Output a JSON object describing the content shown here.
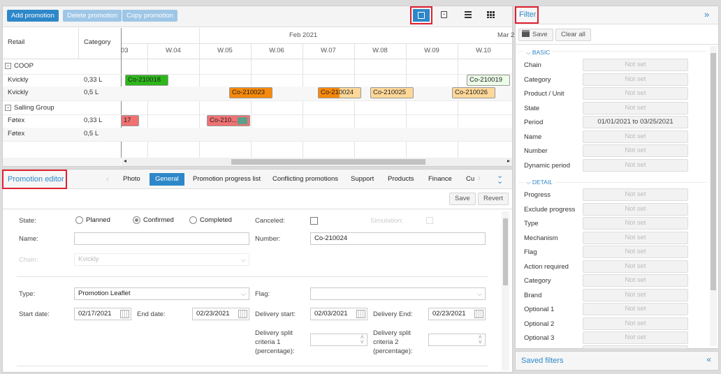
{
  "toolbar": {
    "add": "Add promotion",
    "delete": "Delete promotion",
    "copy": "Copy promotion"
  },
  "grid": {
    "col_retail": "Retail",
    "col_category": "Category",
    "months": [
      "Feb 2021",
      "Mar 2"
    ],
    "weeks": [
      "03",
      "W.04",
      "W.05",
      "W.06",
      "W.07",
      "W.08",
      "W.09",
      "W.10"
    ],
    "rows": [
      {
        "group": "COOP"
      },
      {
        "retail": "Kvickly",
        "category": "0,33 L"
      },
      {
        "retail": "Kvickly",
        "category": "0,5 L"
      },
      {
        "group": "Salling Group"
      },
      {
        "retail": "Føtex",
        "category": "0,33 L"
      },
      {
        "retail": "Føtex",
        "category": "0,5 L"
      }
    ],
    "bars": [
      {
        "label": "Co-210018",
        "color": "#2db71b"
      },
      {
        "label": "Co-210019",
        "color": "#ecfde8"
      },
      {
        "label": "Co-210023",
        "color": "#f7890a"
      },
      {
        "label": "Co-210024",
        "color": "#f7890a"
      },
      {
        "label": "Co-210025",
        "color": "#ffd898"
      },
      {
        "label": "Co-210026",
        "color": "#ffd898"
      },
      {
        "label": "17",
        "color": "#f07272"
      },
      {
        "label": "Co-210...",
        "color": "#f07272"
      }
    ]
  },
  "editor": {
    "title": "Promotion editor",
    "tabs": [
      "Photo",
      "General",
      "Promotion progress list",
      "Conflicting promotions",
      "Support",
      "Products",
      "Finance",
      "Cu:"
    ],
    "active_tab": "General",
    "save": "Save",
    "revert": "Revert",
    "state_label": "State:",
    "states": [
      "Planned",
      "Confirmed",
      "Completed"
    ],
    "state_selected": "Confirmed",
    "canceled_label": "Canceled:",
    "simulation_label": "Simulation:",
    "name_label": "Name:",
    "name_value": "",
    "number_label": "Number:",
    "number_value": "Co-210024",
    "chain_label": "Chain:",
    "chain_value": "Kvickly",
    "type_label": "Type:",
    "type_value": "Promotion Leaflet",
    "flag_label": "Flag:",
    "flag_value": "",
    "start_label": "Start date:",
    "start_value": "02/17/2021",
    "end_label": "End date:",
    "end_value": "02/23/2021",
    "dstart_label": "Delivery start:",
    "dstart_value": "02/03/2021",
    "dend_label": "Delivery End:",
    "dend_value": "02/23/2021",
    "split1_label": [
      "Delivery split",
      "criteria 1",
      "(percentage):"
    ],
    "split2_label": [
      "Delivery split",
      "criteria 2",
      "(percentage):"
    ]
  },
  "filter": {
    "title": "Filter",
    "save": "Save",
    "clear": "Clear all",
    "basic": "BASIC",
    "detail": "DETAIL",
    "basic_rows": [
      {
        "label": "Chain",
        "value": "Not set"
      },
      {
        "label": "Category",
        "value": "Not set"
      },
      {
        "label": "Product / Unit",
        "value": "Not set"
      },
      {
        "label": "State",
        "value": "Not set"
      },
      {
        "label": "Period",
        "value": "01/01/2021 to 03/25/2021"
      },
      {
        "label": "Name",
        "value": "Not set"
      },
      {
        "label": "Number",
        "value": "Not set"
      },
      {
        "label": "Dynamic period",
        "value": "Not set"
      }
    ],
    "detail_rows": [
      {
        "label": "Progress",
        "value": "Not set"
      },
      {
        "label": "Exclude progress",
        "value": "Not set"
      },
      {
        "label": "Type",
        "value": "Not set"
      },
      {
        "label": "Mechanism",
        "value": "Not set"
      },
      {
        "label": "Flag",
        "value": "Not set"
      },
      {
        "label": "Action required",
        "value": "Not set"
      },
      {
        "label": "Category",
        "value": "Not set"
      },
      {
        "label": "Brand",
        "value": "Not set"
      },
      {
        "label": "Optional 1",
        "value": "Not set"
      },
      {
        "label": "Optional 2",
        "value": "Not set"
      },
      {
        "label": "Optional 3",
        "value": "Not set"
      }
    ],
    "saved": "Saved filters"
  }
}
